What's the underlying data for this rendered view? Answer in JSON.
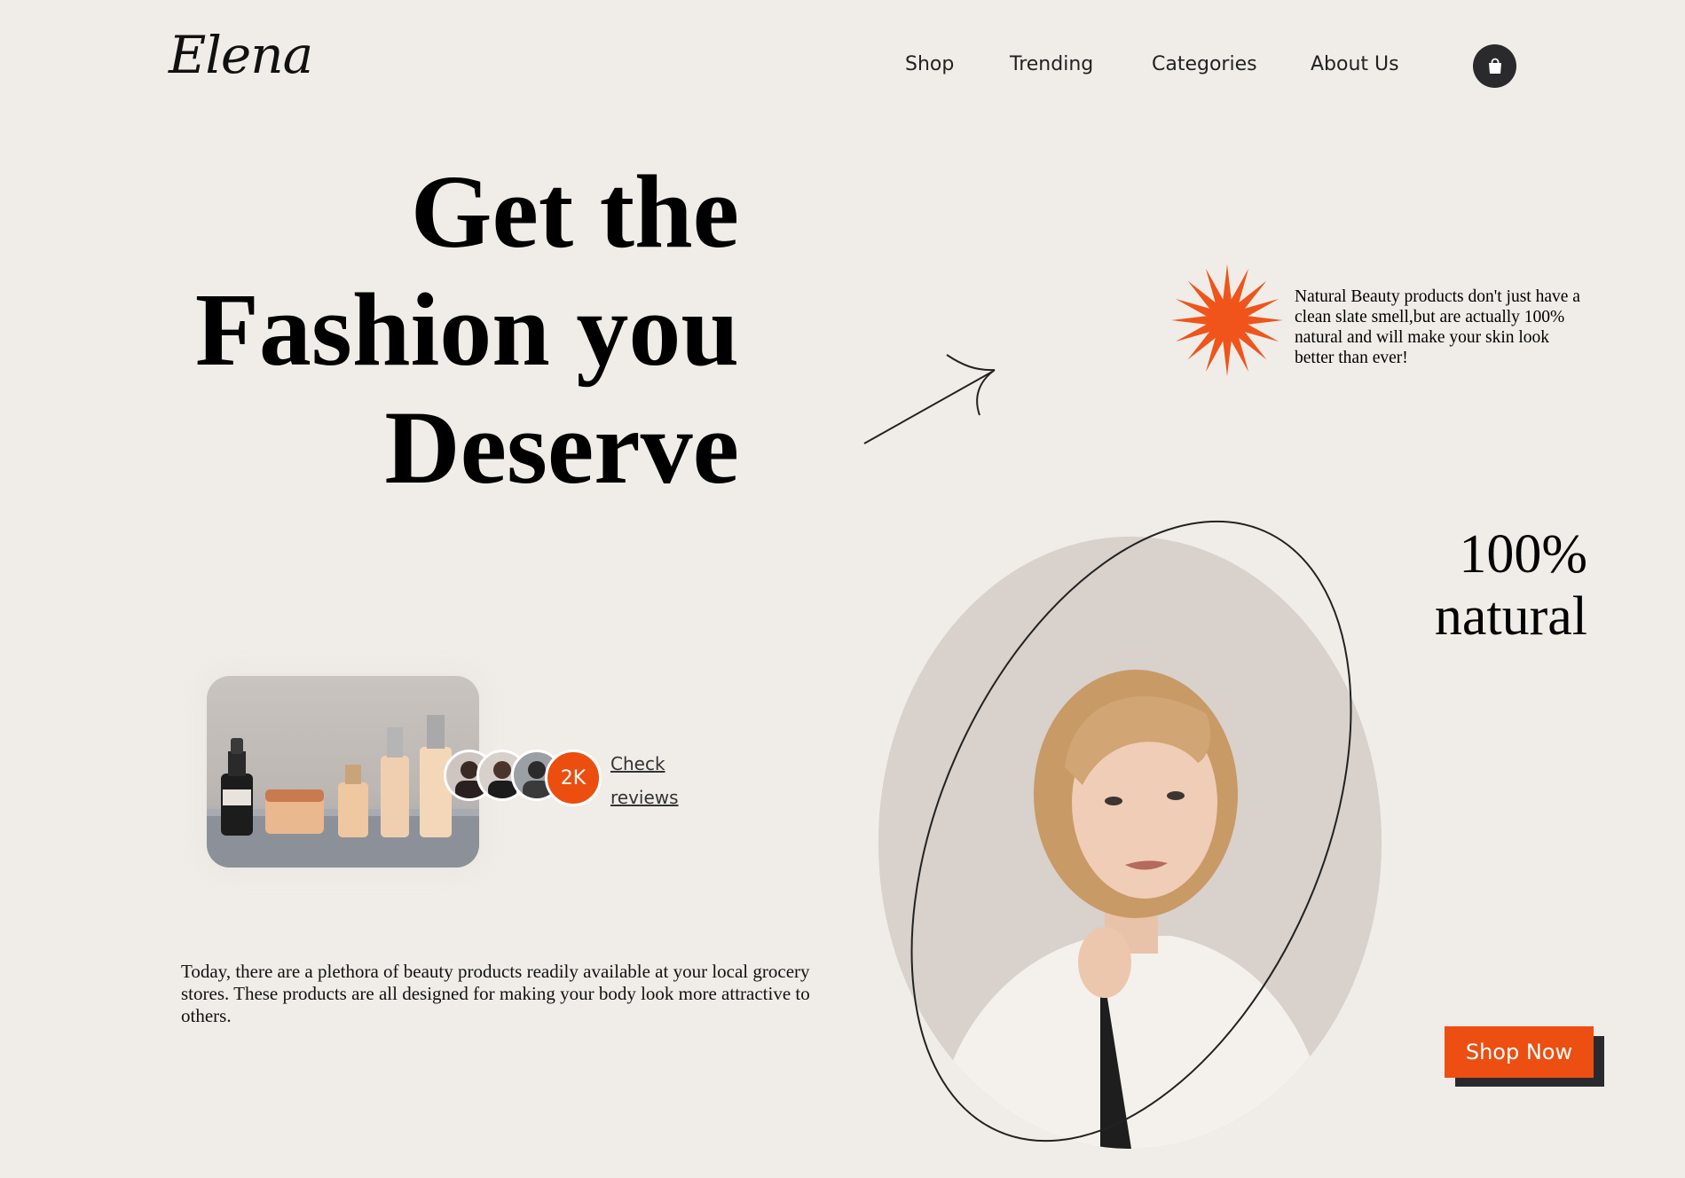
{
  "header": {
    "logo": "Elena",
    "nav": [
      "Shop",
      "Trending",
      "Categories",
      "About Us"
    ],
    "cart_icon": "shopping-bag-icon"
  },
  "hero": {
    "headline_lines": [
      "Get the",
      "Fashion you",
      "Deserve"
    ],
    "description": "Natural Beauty products don't just have a clean slate smell,but are actually 100% natural and will make your skin look better than ever!",
    "highlight_lines": [
      "100%",
      "natural"
    ],
    "body_text": "Today, there are a plethora of beauty products readily available at your local grocery stores. These products are all designed for making your body look more attractive to others."
  },
  "reviews": {
    "count_badge": "2K",
    "link_lines": [
      "Check",
      "reviews"
    ]
  },
  "cta": {
    "label": "Shop Now"
  },
  "colors": {
    "background": "#f0ede8",
    "accent": "#ec4e0f",
    "dark": "#2a2a2d"
  }
}
